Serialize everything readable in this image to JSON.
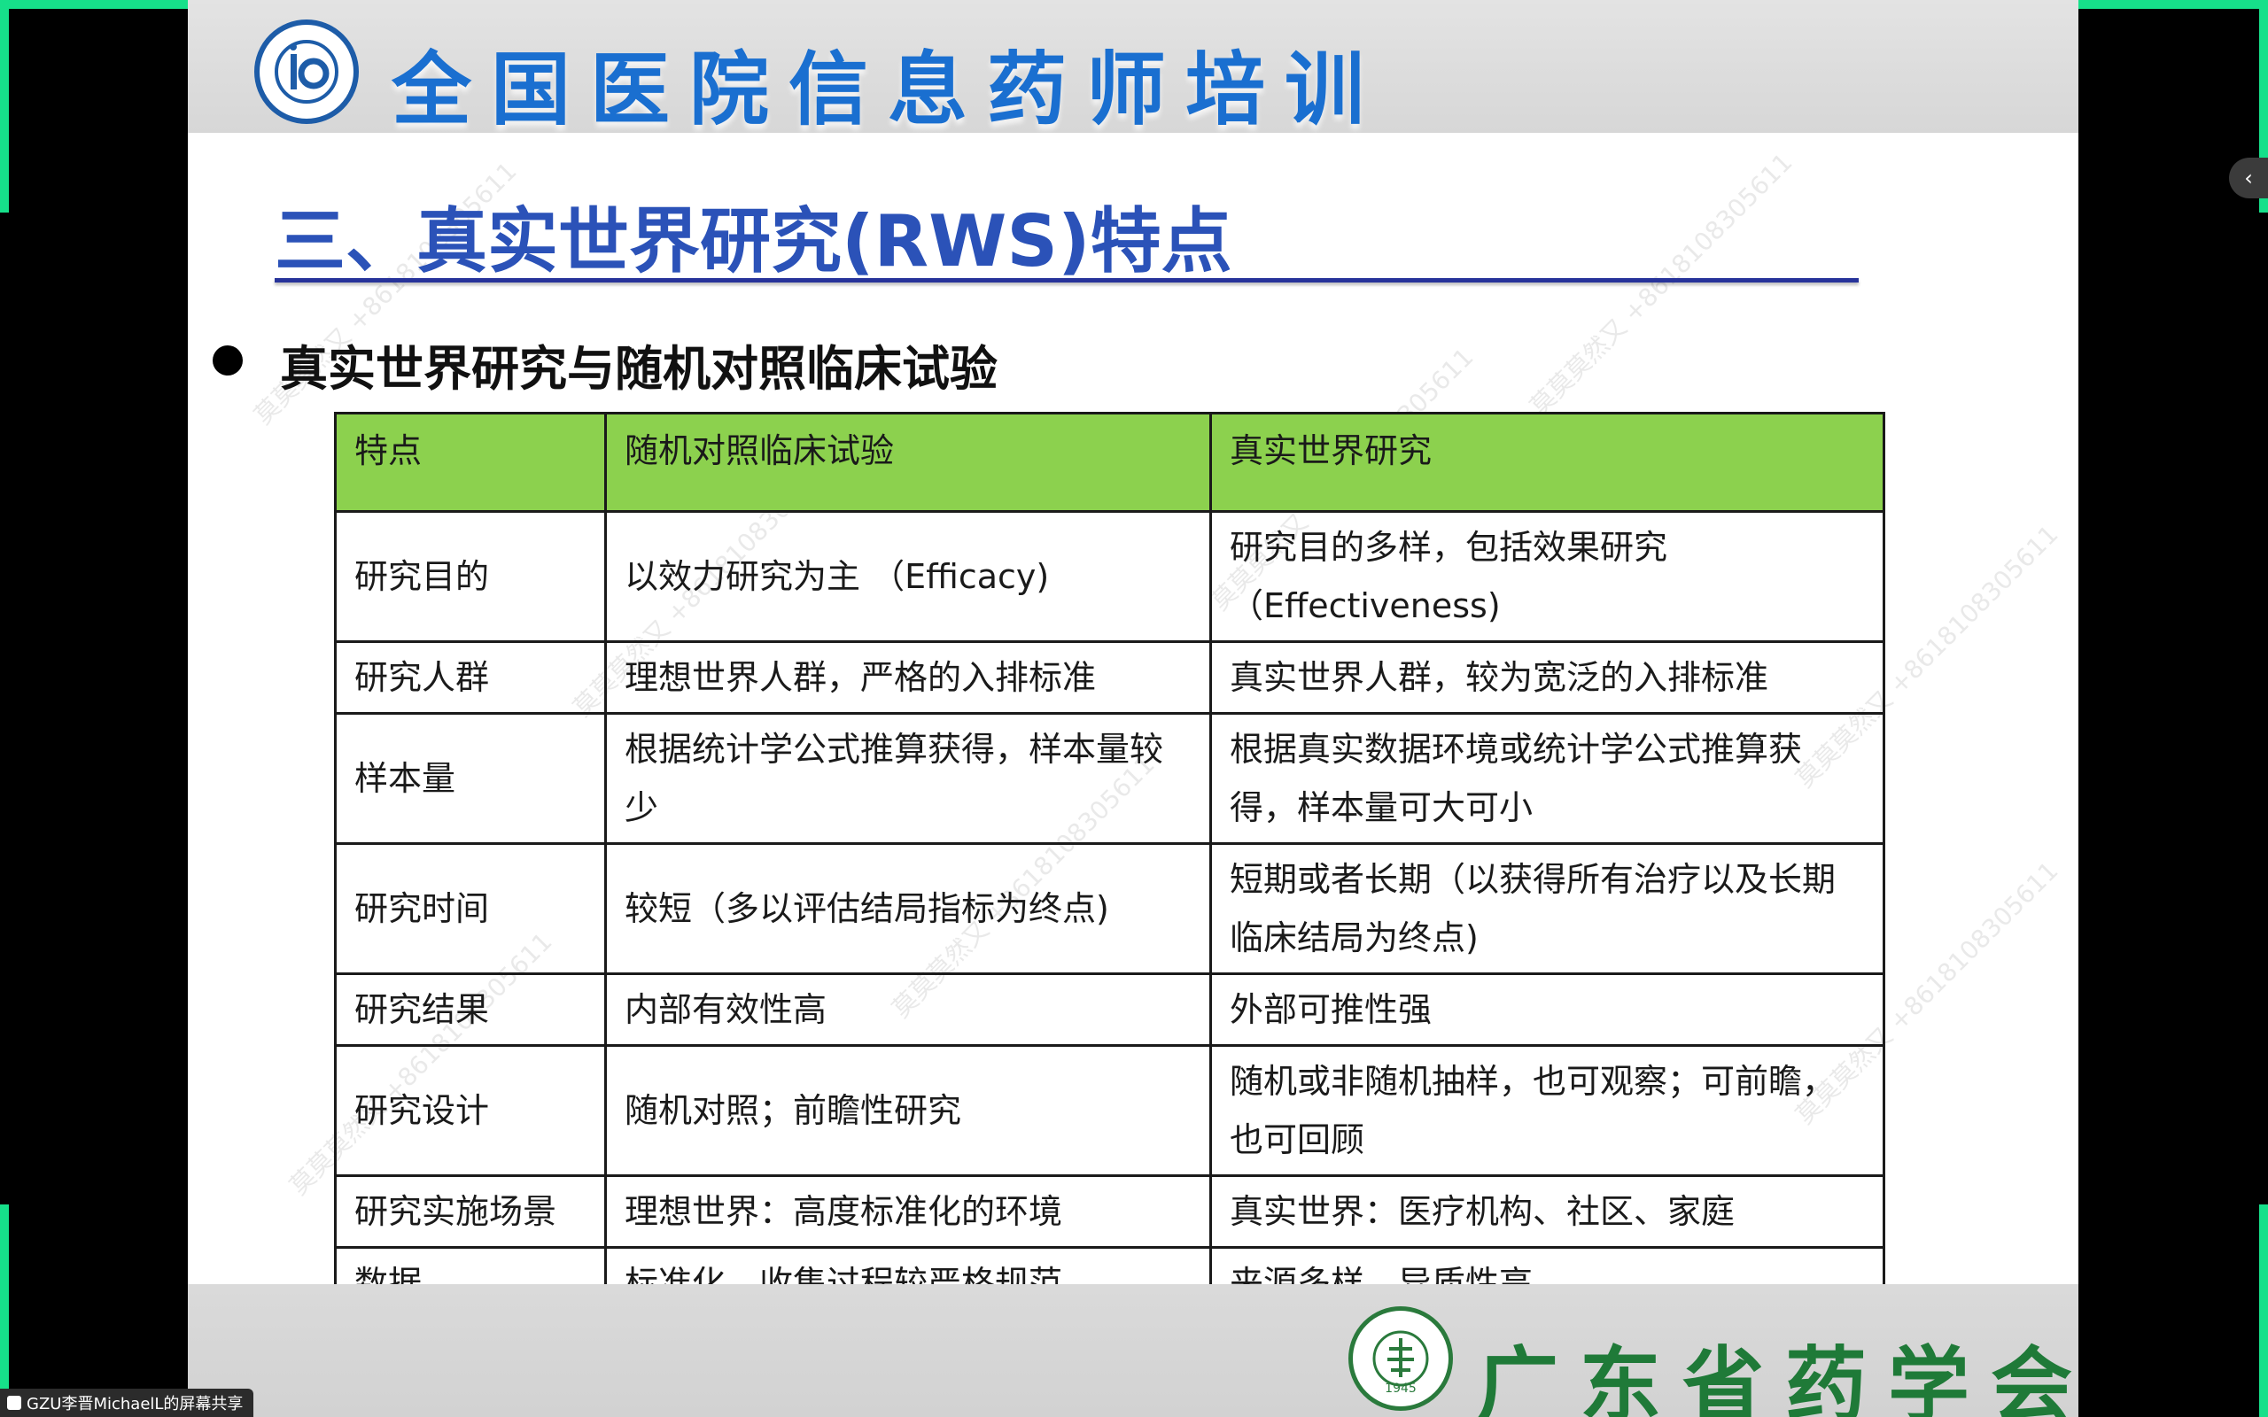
{
  "header": {
    "title": "全国医院信息药师培训"
  },
  "slide": {
    "title": "三、真实世界研究(RWS)特点",
    "bullet": "真实世界研究与随机对照临床试验"
  },
  "table": {
    "headers": [
      "特点",
      "随机对照临床试验",
      "真实世界研究"
    ],
    "rows": [
      {
        "feature": "研究目的",
        "rct": "以效力研究为主 （Efficacy)",
        "rws": "研究目的多样，包括效果研究（Effectiveness)"
      },
      {
        "feature": "研究人群",
        "rct": "理想世界人群，严格的入排标准",
        "rws": "真实世界人群，较为宽泛的入排标准"
      },
      {
        "feature": "样本量",
        "rct": "根据统计学公式推算获得，样本量较少",
        "rws": "根据真实数据环境或统计学公式推算获得，样本量可大可小"
      },
      {
        "feature": "研究时间",
        "rct": "较短（多以评估结局指标为终点)",
        "rws": "短期或者长期（以获得所有治疗以及长期临床结局为终点)"
      },
      {
        "feature": "研究结果",
        "rct": "内部有效性高",
        "rws": "外部可推性强"
      },
      {
        "feature": "研究设计",
        "rct": "随机对照；前瞻性研究",
        "rws": "随机或非随机抽样，也可观察；可前瞻，也可回顾"
      },
      {
        "feature": "研究实施场景",
        "rct": "理想世界：高度标准化的环境",
        "rws": "真实世界：医疗机构、社区、家庭"
      },
      {
        "feature": "数据",
        "rct": "标准化，收集过程较严格规范",
        "rws": "来源多样，异质性高"
      }
    ]
  },
  "footer": {
    "org_name": "广东省药学会",
    "seal_year": "1945"
  },
  "watermark": {
    "text": "莫莫莫然又 +8618108305611"
  },
  "share_bar": {
    "label": "GZU李晋MichaelL的屏幕共享"
  },
  "side_tab": {
    "glyph": "‹"
  },
  "colors": {
    "header_title": "#1a6fd0",
    "slide_title": "#2b52b8",
    "table_header_bg": "#8cd14e",
    "org_name": "#1f7a38",
    "corner_marks": "#16e08a"
  }
}
